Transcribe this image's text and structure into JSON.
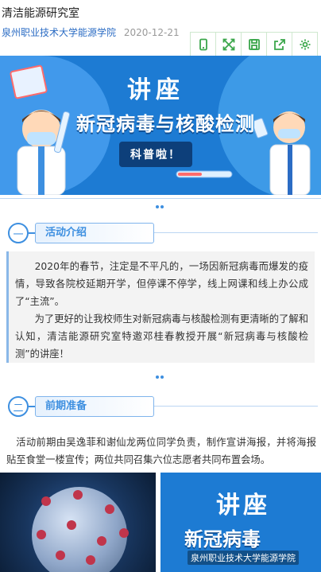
{
  "article": {
    "title": "清洁能源研究室",
    "author": "泉州职业技术大学能源学院",
    "date": "2020-12-21"
  },
  "toolbar": {
    "icons": [
      "phone-icon",
      "expand-icon",
      "save-icon",
      "share-icon",
      "settings-icon"
    ]
  },
  "banner": {
    "heading": "讲座",
    "subtitle": "新冠病毒与核酸检测",
    "badge": "科普啦！"
  },
  "section1": {
    "number": "一",
    "title": "活动介绍",
    "paragraphs": [
      "2020年的春节，注定是不平凡的，一场因新冠病毒而爆发的疫情，导致各院校延期开学，但停课不停学，线上网课和线上办公成了“主流”。",
      "为了更好的让我校师生对新冠病毒与核酸检测有更清晰的了解和认知，清洁能源研究室特邀邓桂春教授开展“新冠病毒与核酸检测”的讲座！"
    ]
  },
  "section2": {
    "number": "二",
    "title": "前期准备",
    "paragraph": "活动前期由吴逸菲和谢仙龙两位同学负责，制作宣讲海报，并将海报贴至食堂一楼宣传；两位共同召集六位志愿者共同布置会场。"
  },
  "photos": {
    "poster_heading": "讲座",
    "poster_subtitle": "新冠病毒",
    "watermark": "泉州职业技术大学能源学院"
  }
}
